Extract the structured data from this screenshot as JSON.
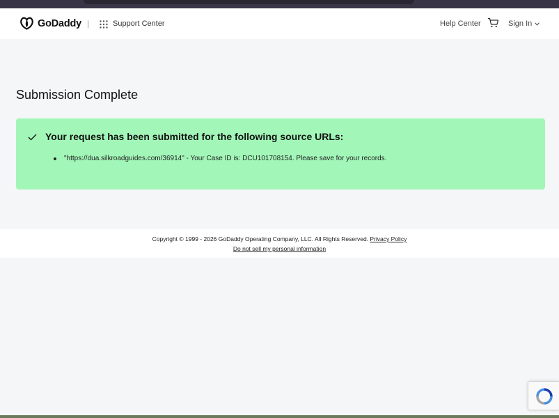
{
  "header": {
    "brand": "GoDaddy",
    "divider": "|",
    "support_center": "Support Center",
    "help_center": "Help Center",
    "sign_in": "Sign In"
  },
  "main": {
    "title": "Submission Complete",
    "alert": {
      "heading": "Your request has been submitted for the following source URLs:",
      "items": [
        "\"https://dua.silkroadguides.com/36914\" - Your Case ID is: DCU101708154. Please save for your records."
      ],
      "color": "#a2f7b8"
    }
  },
  "footer": {
    "copyright": "Copyright © 1999 - 2026 GoDaddy Operating Company, LLC. All Rights Reserved.",
    "privacy_policy": "Privacy Policy",
    "do_not_sell": "Do not sell my personal information"
  },
  "icons": {
    "logo": "godaddy-logo-icon",
    "apps": "grid-apps-icon",
    "cart": "cart-icon",
    "chevron": "chevron-down-icon",
    "check": "check-icon",
    "recaptcha": "recaptcha-icon"
  }
}
